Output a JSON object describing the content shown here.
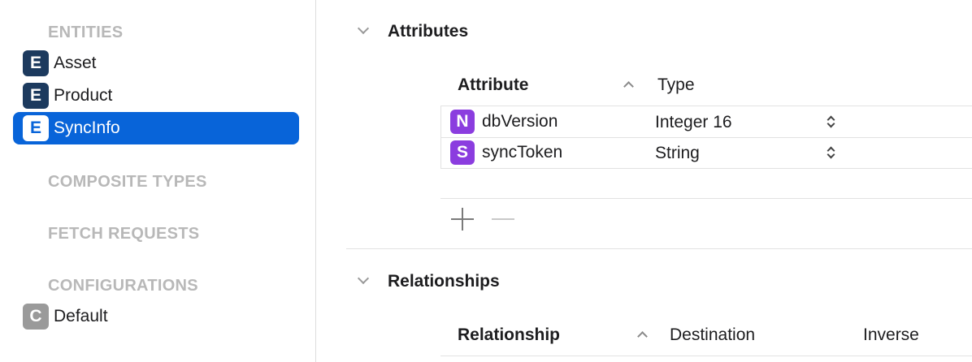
{
  "sidebar": {
    "sections": {
      "entities": "ENTITIES",
      "composite_types": "COMPOSITE TYPES",
      "fetch_requests": "FETCH REQUESTS",
      "configurations": "CONFIGURATIONS"
    },
    "entities": [
      {
        "badge": "E",
        "label": "Asset",
        "selected": false
      },
      {
        "badge": "E",
        "label": "Product",
        "selected": false
      },
      {
        "badge": "E",
        "label": "SyncInfo",
        "selected": true
      }
    ],
    "configurations": [
      {
        "badge": "C",
        "label": "Default"
      }
    ]
  },
  "attributes": {
    "title": "Attributes",
    "col_attribute": "Attribute",
    "col_type": "Type",
    "rows": [
      {
        "badge": "N",
        "name": "dbVersion",
        "type": "Integer 16"
      },
      {
        "badge": "S",
        "name": "syncToken",
        "type": "String"
      }
    ]
  },
  "relationships": {
    "title": "Relationships",
    "col_relationship": "Relationship",
    "col_destination": "Destination",
    "col_inverse": "Inverse"
  },
  "icons": {
    "section_toggle": "chevron-down-icon",
    "sort": "chevron-up-icon",
    "add": "plus-icon",
    "remove": "minus-icon",
    "type_popup": "up-down-chevron-icon"
  },
  "colors": {
    "selection": "#0864d9",
    "entity_badge": "#1c3a5e",
    "attribute_badge": "#8b3ddf",
    "configuration_badge": "#9a9a9a",
    "section_header": "#b8b8b8"
  }
}
